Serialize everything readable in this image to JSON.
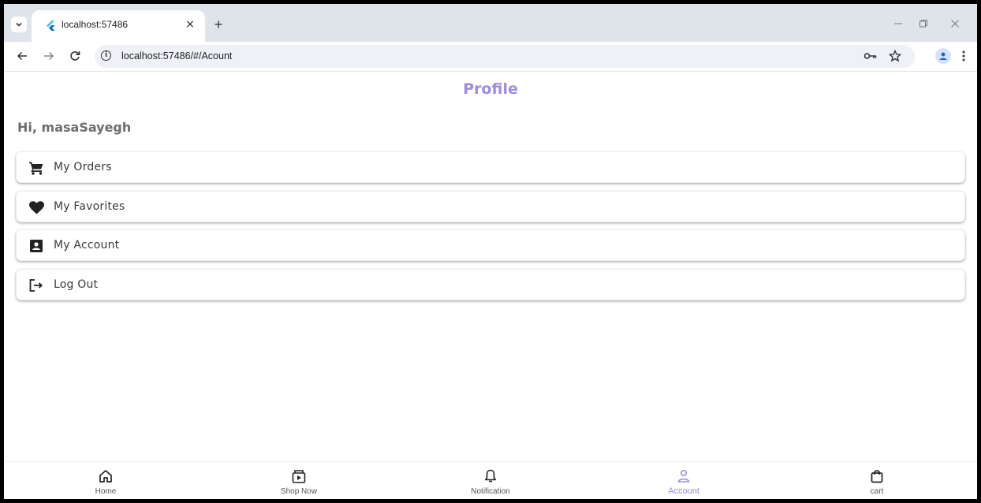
{
  "browser": {
    "tab_title": "localhost:57486",
    "url": "localhost:57486/#/Acount",
    "close_glyph": "×",
    "new_tab_glyph": "+"
  },
  "page": {
    "title": "Profile",
    "greeting": "Hi, masaSayegh"
  },
  "menu": [
    {
      "label": "My Orders",
      "icon": "cart-icon"
    },
    {
      "label": "My Favorites",
      "icon": "heart-icon"
    },
    {
      "label": "My Account",
      "icon": "account-box-icon"
    },
    {
      "label": "Log Out",
      "icon": "logout-icon"
    }
  ],
  "bottom_nav": [
    {
      "label": "Home",
      "icon": "home-icon",
      "active": false
    },
    {
      "label": "Shop Now",
      "icon": "shop-icon",
      "active": false
    },
    {
      "label": "Notification",
      "icon": "bell-icon",
      "active": false
    },
    {
      "label": "Account",
      "icon": "person-icon",
      "active": true
    },
    {
      "label": "cart",
      "icon": "bag-icon",
      "active": false
    }
  ],
  "colors": {
    "accent": "#9b8de0",
    "greeting": "#6d6d6d",
    "chrome": "#dfe3ea"
  }
}
